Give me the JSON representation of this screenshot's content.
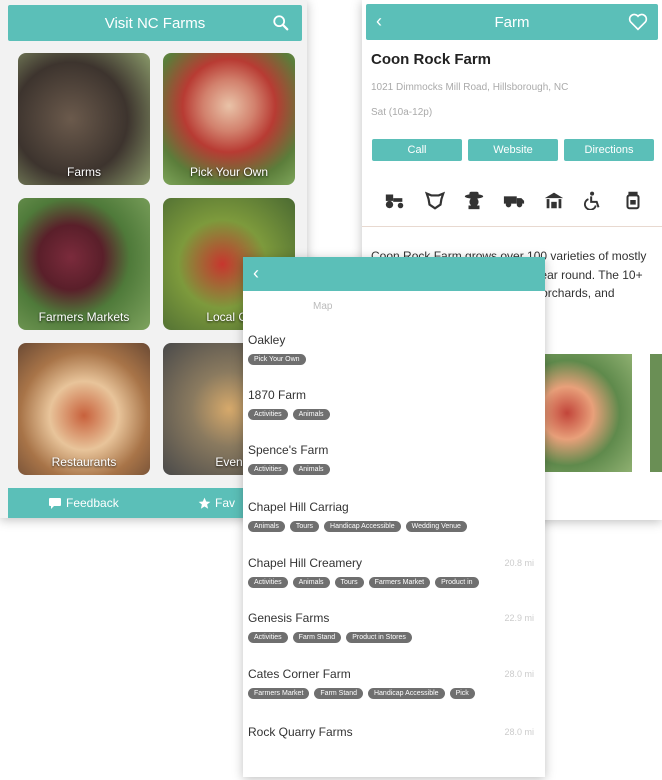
{
  "home": {
    "title": "Visit NC Farms",
    "tiles": [
      {
        "label": "Farms"
      },
      {
        "label": "Pick Your Own"
      },
      {
        "label": "Farmers Markets"
      },
      {
        "label": "Local Gr"
      },
      {
        "label": "Restaurants"
      },
      {
        "label": "Even"
      }
    ],
    "footer": {
      "feedback": "Feedback",
      "favorites": "Fav"
    }
  },
  "farm": {
    "title": "Farm",
    "name": "Coon Rock Farm",
    "address": "1021 Dimmocks Mill Road, Hillsborough, NC",
    "hours": "Sat (10a-12p)",
    "buttons": {
      "call": "Call",
      "website": "Website",
      "directions": "Directions"
    },
    "description": "Coon Rock Farm grows over 100 varieties of mostly heirloom vegetables and fruits year round. The 10+ acres holds vegetable gardens, orchards, and ponds."
  },
  "list": {
    "map_tab": "Map",
    "farms": [
      {
        "name": "Oakley",
        "dist": "",
        "tags": [
          "Pick Your Own"
        ]
      },
      {
        "name": "1870 Farm",
        "dist": "",
        "tags": [
          "Activities",
          "Animals"
        ]
      },
      {
        "name": "Spence's Farm",
        "dist": "",
        "tags": [
          "Activities",
          "Animals"
        ]
      },
      {
        "name": "Chapel Hill Carriag",
        "dist": "",
        "tags": [
          "Animals",
          "Tours",
          "Handicap Accessible",
          "Wedding Venue"
        ]
      },
      {
        "name": "Chapel Hill Creamery",
        "dist": "20.8 mi",
        "tags": [
          "Activities",
          "Animals",
          "Tours",
          "Farmers Market",
          "Product in"
        ]
      },
      {
        "name": "Genesis Farms",
        "dist": "22.9 mi",
        "tags": [
          "Activities",
          "Farm Stand",
          "Product in Stores"
        ]
      },
      {
        "name": "Cates Corner Farm",
        "dist": "28.0 mi",
        "tags": [
          "Farmers Market",
          "Farm Stand",
          "Handicap Accessible",
          "Pick"
        ]
      },
      {
        "name": "Rock Quarry Farms",
        "dist": "28.0 mi",
        "tags": []
      }
    ]
  }
}
